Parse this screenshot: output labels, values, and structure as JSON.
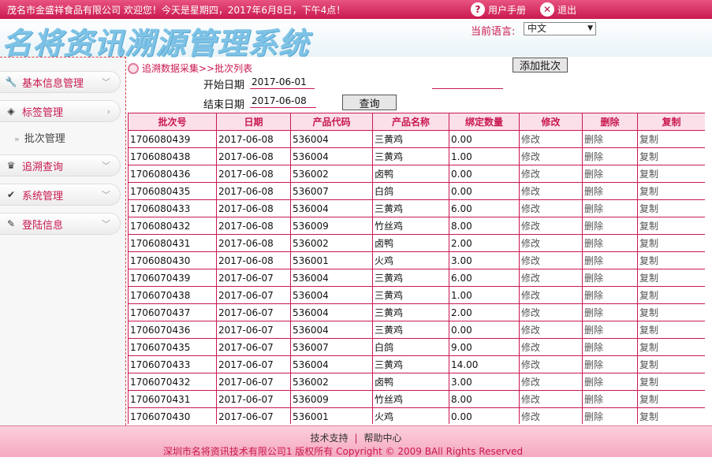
{
  "topbar": {
    "greeting": "茂名市金盛祥食品有限公司 欢迎您！今天是星期四，2017年6月8日，下午4点！",
    "manual_label": "用户手册",
    "logout_label": "退出"
  },
  "header": {
    "logo_text": "名将资讯溯源管理系统",
    "language_label": "当前语言:",
    "language_value": "中文"
  },
  "sidebar": {
    "items": [
      {
        "label": "基本信息管理",
        "icon": "wrench-icon"
      },
      {
        "label": "标签管理",
        "icon": "gem-icon"
      },
      {
        "label": "追溯查询",
        "icon": "crown-icon"
      },
      {
        "label": "系统管理",
        "icon": "check-icon"
      },
      {
        "label": "登陆信息",
        "icon": "pencil-icon"
      }
    ],
    "sub_item": "批次管理"
  },
  "main": {
    "breadcrumb": "追溯数据采集>>批次列表",
    "add_batch_label": "添加批次",
    "start_date_label": "开始日期",
    "start_date_value": "2017-06-01",
    "end_date_label": "结束日期",
    "end_date_value": "2017-06-08",
    "search_label": "查询"
  },
  "table": {
    "headers": [
      "批次号",
      "日期",
      "产品代码",
      "产品名称",
      "绑定数量",
      "修改",
      "删除",
      "复制"
    ],
    "rows": [
      [
        "1706080439",
        "2017-06-08",
        "536004",
        "三黄鸡",
        "0.00",
        "修改",
        "删除",
        "复制"
      ],
      [
        "1706080438",
        "2017-06-08",
        "536004",
        "三黄鸡",
        "1.00",
        "修改",
        "删除",
        "复制"
      ],
      [
        "1706080436",
        "2017-06-08",
        "536002",
        "卤鸭",
        "0.00",
        "修改",
        "删除",
        "复制"
      ],
      [
        "1706080435",
        "2017-06-08",
        "536007",
        "白鸽",
        "0.00",
        "修改",
        "删除",
        "复制"
      ],
      [
        "1706080433",
        "2017-06-08",
        "536004",
        "三黄鸡",
        "6.00",
        "修改",
        "删除",
        "复制"
      ],
      [
        "1706080432",
        "2017-06-08",
        "536009",
        "竹丝鸡",
        "8.00",
        "修改",
        "删除",
        "复制"
      ],
      [
        "1706080431",
        "2017-06-08",
        "536002",
        "卤鸭",
        "2.00",
        "修改",
        "删除",
        "复制"
      ],
      [
        "1706080430",
        "2017-06-08",
        "536001",
        "火鸡",
        "3.00",
        "修改",
        "删除",
        "复制"
      ],
      [
        "1706070439",
        "2017-06-07",
        "536004",
        "三黄鸡",
        "6.00",
        "修改",
        "删除",
        "复制"
      ],
      [
        "1706070438",
        "2017-06-07",
        "536004",
        "三黄鸡",
        "1.00",
        "修改",
        "删除",
        "复制"
      ],
      [
        "1706070437",
        "2017-06-07",
        "536004",
        "三黄鸡",
        "2.00",
        "修改",
        "删除",
        "复制"
      ],
      [
        "1706070436",
        "2017-06-07",
        "536004",
        "三黄鸡",
        "0.00",
        "修改",
        "删除",
        "复制"
      ],
      [
        "1706070435",
        "2017-06-07",
        "536007",
        "白鸽",
        "9.00",
        "修改",
        "删除",
        "复制"
      ],
      [
        "1706070433",
        "2017-06-07",
        "536004",
        "三黄鸡",
        "14.00",
        "修改",
        "删除",
        "复制"
      ],
      [
        "1706070432",
        "2017-06-07",
        "536002",
        "卤鸭",
        "3.00",
        "修改",
        "删除",
        "复制"
      ],
      [
        "1706070431",
        "2017-06-07",
        "536009",
        "竹丝鸡",
        "8.00",
        "修改",
        "删除",
        "复制"
      ],
      [
        "1706070430",
        "2017-06-07",
        "536001",
        "火鸡",
        "0.00",
        "修改",
        "删除",
        "复制"
      ]
    ]
  },
  "footer": {
    "tech_support": "技术支持",
    "help_center": "帮助中心",
    "copyright": "深圳市名将资讯技术有限公司1  版权所有   Copyright © 2009 BAll Rights Reserved"
  }
}
